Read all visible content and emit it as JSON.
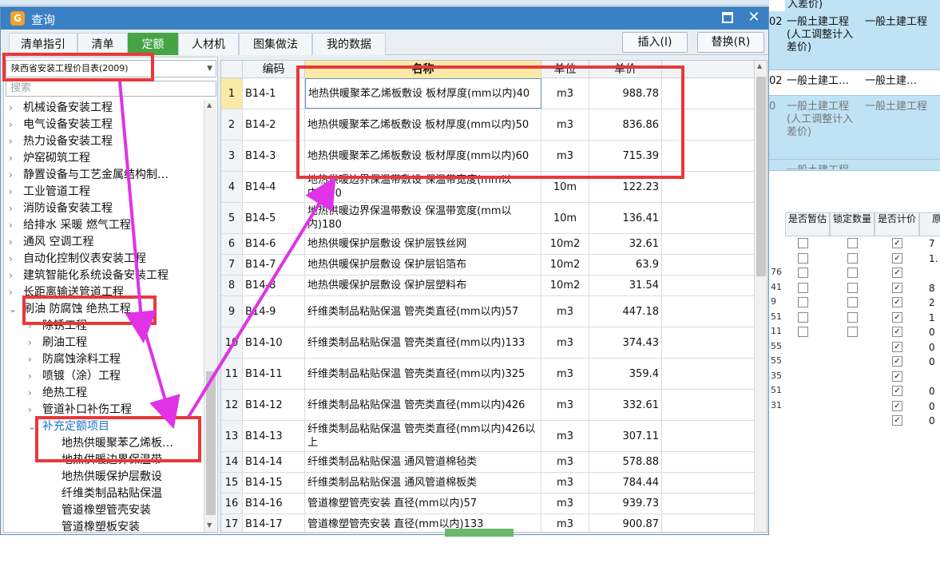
{
  "app": {
    "title": "查询",
    "icon_char": "G"
  },
  "window_controls": {
    "maximize": "maximize",
    "close": "✕"
  },
  "tabs": [
    {
      "label": "清单指引",
      "active": false
    },
    {
      "label": "清单",
      "active": false
    },
    {
      "label": "定额",
      "active": true
    },
    {
      "label": "人材机",
      "active": false
    },
    {
      "label": "图集做法",
      "active": false
    },
    {
      "label": "我的数据",
      "active": false
    }
  ],
  "toolbar": {
    "insert_label": "插入(I)",
    "replace_label": "替换(R)"
  },
  "library": {
    "selected": "陕西省安装工程价目表(2009)",
    "search_placeholder": "搜索"
  },
  "tree": [
    {
      "label": "机械设备安装工程",
      "level": 0,
      "expanded": false
    },
    {
      "label": "电气设备安装工程",
      "level": 0,
      "expanded": false
    },
    {
      "label": "热力设备安装工程",
      "level": 0,
      "expanded": false
    },
    {
      "label": "炉窑砌筑工程",
      "level": 0,
      "expanded": false
    },
    {
      "label": "静置设备与工艺金属结构制…",
      "level": 0,
      "expanded": false
    },
    {
      "label": "工业管道工程",
      "level": 0,
      "expanded": false
    },
    {
      "label": "消防设备安装工程",
      "level": 0,
      "expanded": false
    },
    {
      "label": "给排水 采暖 燃气工程",
      "level": 0,
      "expanded": false
    },
    {
      "label": "通风 空调工程",
      "level": 0,
      "expanded": false
    },
    {
      "label": "自动化控制仪表安装工程",
      "level": 0,
      "expanded": false
    },
    {
      "label": "建筑智能化系统设备安装工程",
      "level": 0,
      "expanded": false
    },
    {
      "label": "长距离输送管道工程",
      "level": 0,
      "expanded": false
    },
    {
      "label": "刷油 防腐蚀 绝热工程",
      "level": 0,
      "expanded": true
    },
    {
      "label": "除锈工程",
      "level": 1,
      "expanded": false
    },
    {
      "label": "刷油工程",
      "level": 1,
      "expanded": false
    },
    {
      "label": "防腐蚀涂料工程",
      "level": 1,
      "expanded": false
    },
    {
      "label": "喷镀（涂）工程",
      "level": 1,
      "expanded": false
    },
    {
      "label": "绝热工程",
      "level": 1,
      "expanded": false
    },
    {
      "label": "管道补口补伤工程",
      "level": 1,
      "expanded": false
    },
    {
      "label": "补充定额项目",
      "level": 1,
      "expanded": true,
      "selected": true
    },
    {
      "label": "地热供暖聚苯乙烯板…",
      "level": 2
    },
    {
      "label": "地热供暖边界保温带",
      "level": 2
    },
    {
      "label": "地热供暖保护层敷设",
      "level": 2
    },
    {
      "label": "纤维类制品粘贴保温",
      "level": 2
    },
    {
      "label": "管道橡塑管壳安装",
      "level": 2
    },
    {
      "label": "管道橡塑板安装",
      "level": 2
    }
  ],
  "grid": {
    "headers": {
      "code": "编码",
      "name": "名称",
      "unit": "单位",
      "price": "单价"
    },
    "rows": [
      {
        "idx": "1",
        "code": "B14-1",
        "name": "地热供暖聚苯乙烯板敷设 板材厚度(mm以内)40",
        "unit": "m3",
        "price": "988.78"
      },
      {
        "idx": "2",
        "code": "B14-2",
        "name": "地热供暖聚苯乙烯板敷设 板材厚度(mm以内)50",
        "unit": "m3",
        "price": "836.86"
      },
      {
        "idx": "3",
        "code": "B14-3",
        "name": "地热供暖聚苯乙烯板敷设 板材厚度(mm以内)60",
        "unit": "m3",
        "price": "715.39"
      },
      {
        "idx": "4",
        "code": "B14-4",
        "name": "地热供暖边界保温带敷设 保温带宽度(mm以内)150",
        "unit": "10m",
        "price": "122.23"
      },
      {
        "idx": "5",
        "code": "B14-5",
        "name": "地热供暖边界保温带敷设 保温带宽度(mm以内)180",
        "unit": "10m",
        "price": "136.41"
      },
      {
        "idx": "6",
        "code": "B14-6",
        "name": "地热供暖保护层敷设 保护层铁丝网",
        "unit": "10m2",
        "price": "32.61"
      },
      {
        "idx": "7",
        "code": "B14-7",
        "name": "地热供暖保护层敷设 保护层铝箔布",
        "unit": "10m2",
        "price": "63.9"
      },
      {
        "idx": "8",
        "code": "B14-8",
        "name": "地热供暖保护层敷设 保护层塑料布",
        "unit": "10m2",
        "price": "31.54"
      },
      {
        "idx": "9",
        "code": "B14-9",
        "name": "纤维类制品粘贴保温 管壳类直径(mm以内)57",
        "unit": "m3",
        "price": "447.18"
      },
      {
        "idx": "10",
        "code": "B14-10",
        "name": "纤维类制品粘贴保温 管壳类直径(mm以内)133",
        "unit": "m3",
        "price": "374.43"
      },
      {
        "idx": "11",
        "code": "B14-11",
        "name": "纤维类制品粘贴保温 管壳类直径(mm以内)325",
        "unit": "m3",
        "price": "359.4"
      },
      {
        "idx": "12",
        "code": "B14-12",
        "name": "纤维类制品粘贴保温 管壳类直径(mm以内)426",
        "unit": "m3",
        "price": "332.61"
      },
      {
        "idx": "13",
        "code": "B14-13",
        "name": "纤维类制品粘贴保温 管壳类直径(mm以内)426以上",
        "unit": "m3",
        "price": "307.11"
      },
      {
        "idx": "14",
        "code": "B14-14",
        "name": "纤维类制品粘贴保温 通风管道棉毡类",
        "unit": "m3",
        "price": "578.88"
      },
      {
        "idx": "15",
        "code": "B14-15",
        "name": "纤维类制品粘贴保温 通风管道棉板类",
        "unit": "m3",
        "price": "784.44"
      },
      {
        "idx": "16",
        "code": "B14-16",
        "name": "管道橡塑管壳安装 直径(mm以内)57",
        "unit": "m3",
        "price": "939.73"
      },
      {
        "idx": "17",
        "code": "B14-17",
        "name": "管道橡塑管壳安装 直径(mm以内)133",
        "unit": "m3",
        "price": "900.87"
      }
    ]
  },
  "background": {
    "top_right_text": "入差价)",
    "project_rows": [
      {
        "code": "02",
        "name": "一般土建工程(人工调整计入差价)",
        "type": "一般土建工程"
      },
      {
        "code": "02",
        "name": "一般土建工…",
        "type": "一般土建…"
      },
      {
        "code": "0",
        "name": "一般土建工程(人工调整计入差价)",
        "type": "一般土建工程"
      },
      {
        "code": "",
        "name": "一般土建工程",
        "type": ""
      }
    ],
    "col_headers": [
      "是否暂估",
      "锁定数量",
      "是否计价",
      "原始"
    ],
    "left_digits": [
      "76",
      "41",
      "9",
      "51",
      "11",
      "55",
      "55",
      "35",
      "51",
      "31"
    ],
    "far_right_digits": [
      "7",
      "1.",
      "",
      "8",
      "2",
      "1",
      "0",
      "0",
      "0",
      "",
      "0",
      "0",
      "0"
    ]
  },
  "colors": {
    "titlebar": "#3a80c4",
    "active_tab": "#45a545",
    "annotation": "#e8383a",
    "arrow": "#e032e6"
  }
}
